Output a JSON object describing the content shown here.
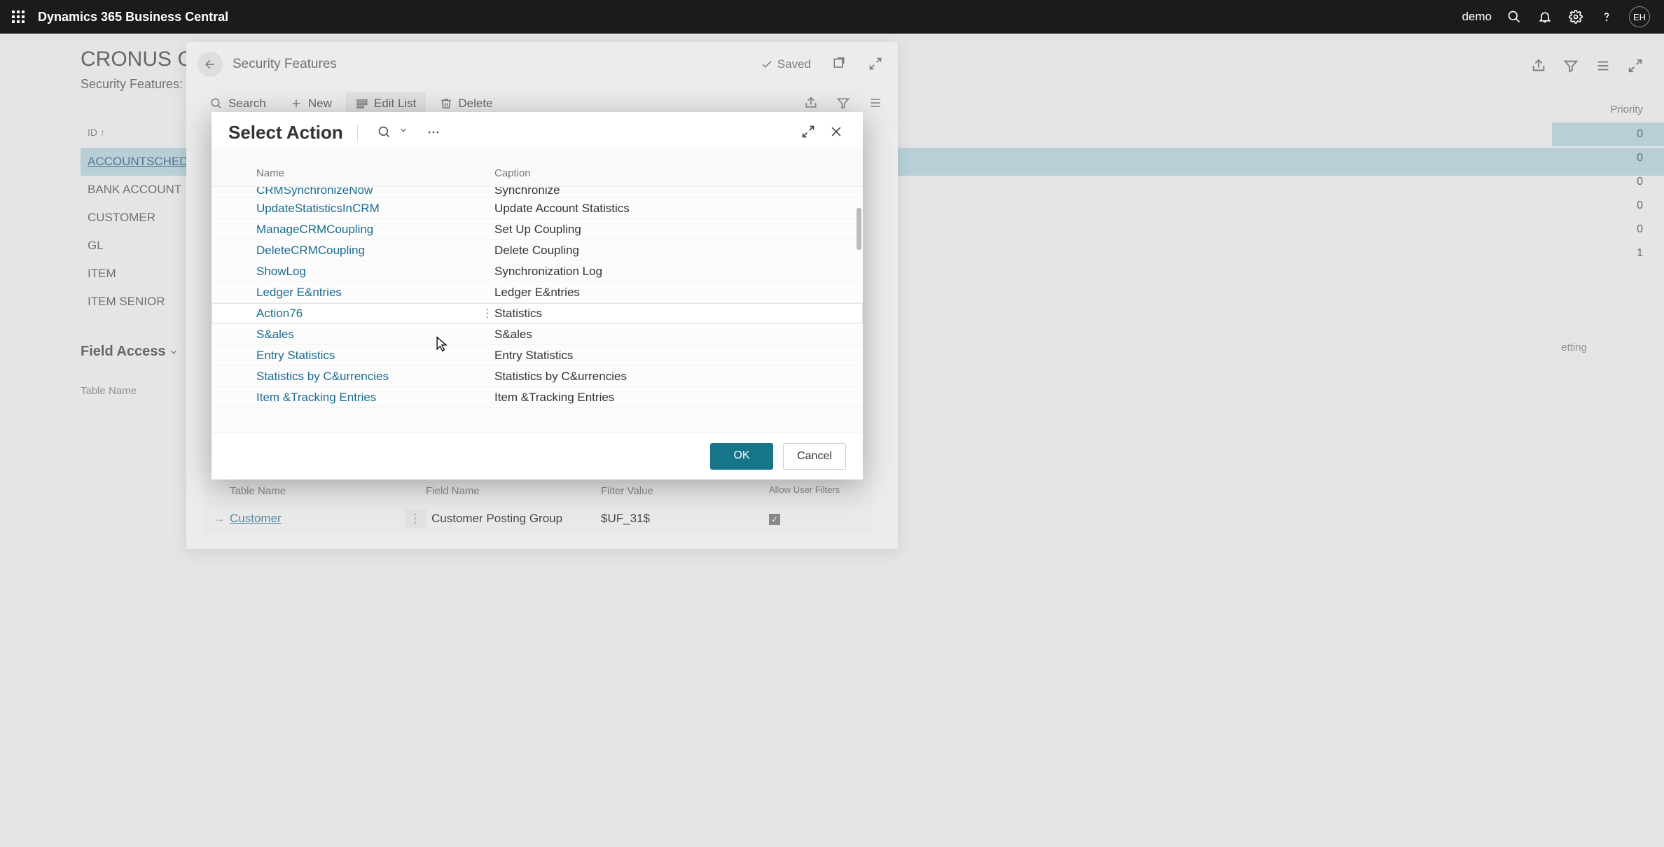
{
  "topbar": {
    "title": "Dynamics 365 Business Central",
    "user_label": "demo",
    "avatar_initials": "EH"
  },
  "background": {
    "company": "CRONUS Canad",
    "subtitle_left": "Security Features:",
    "id_header": "ID ↑",
    "side_items": [
      "ACCOUNTSCHEDULE",
      "BANK ACCOUNT",
      "CUSTOMER",
      "GL",
      "ITEM",
      "ITEM SENIOR"
    ],
    "field_access_label": "Field Access",
    "table_name_label": "Table Name",
    "priority_header": "Priority",
    "priority_values": [
      "0",
      "0",
      "0",
      "0",
      "0",
      "1"
    ],
    "setting_fragment": "etting"
  },
  "page": {
    "title": "Security Features",
    "saved_label": "Saved",
    "toolbar": {
      "search": "Search",
      "new": "New",
      "edit_list": "Edit List",
      "delete": "Delete"
    }
  },
  "modal": {
    "title": "Select Action",
    "columns": {
      "name": "Name",
      "caption": "Caption"
    },
    "rows": [
      {
        "name": "CRMSynchronizeNow",
        "caption": "Synchronize",
        "clipped": true
      },
      {
        "name": "UpdateStatisticsInCRM",
        "caption": "Update Account Statistics"
      },
      {
        "name": "ManageCRMCoupling",
        "caption": "Set Up Coupling"
      },
      {
        "name": "DeleteCRMCoupling",
        "caption": "Delete Coupling"
      },
      {
        "name": "ShowLog",
        "caption": "Synchronization Log"
      },
      {
        "name": "Ledger E&ntries",
        "caption": "Ledger E&ntries"
      },
      {
        "name": "Action76",
        "caption": "Statistics",
        "hover": true
      },
      {
        "name": "S&ales",
        "caption": "S&ales"
      },
      {
        "name": "Entry Statistics",
        "caption": "Entry Statistics"
      },
      {
        "name": "Statistics by C&urrencies",
        "caption": "Statistics by C&urrencies"
      },
      {
        "name": "Item &Tracking Entries",
        "caption": "Item &Tracking Entries"
      }
    ],
    "ok": "OK",
    "cancel": "Cancel"
  },
  "bottom": {
    "headers": {
      "table": "Table Name",
      "field": "Field Name",
      "filter": "Filter Value",
      "allow": "Allow User Filters"
    },
    "row": {
      "table": "Customer",
      "field": "Customer Posting Group",
      "filter": "$UF_31$",
      "checked": true
    }
  }
}
